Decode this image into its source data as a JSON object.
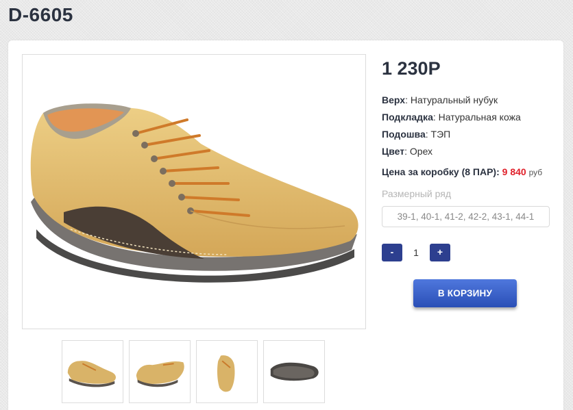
{
  "product": {
    "code": "D-6605",
    "price": "1 230Р"
  },
  "specs": [
    {
      "label": "Верх",
      "value": "Натуральный нубук"
    },
    {
      "label": "Подкладка",
      "value": "Натуральная кожа"
    },
    {
      "label": "Подошва",
      "value": "ТЭП"
    },
    {
      "label": "Цвет",
      "value": "Орех"
    }
  ],
  "box_price": {
    "label": "Цена за коробку (8 ПАР):",
    "value": "9 840",
    "currency": "руб"
  },
  "sizes": {
    "label": "Размерный ряд",
    "value": "39-1, 40-1, 41-2, 42-2, 43-1, 44-1"
  },
  "quantity": {
    "minus_label": "-",
    "value": "1",
    "plus_label": "+"
  },
  "cart": {
    "button_label": "В КОРЗИНУ"
  },
  "gallery": {
    "thumbnails": [
      "shoe-side-view",
      "shoe-angled-view",
      "shoe-front-view",
      "shoe-sole-view"
    ]
  },
  "colors": {
    "button_blue": "#2d3f8f",
    "cart_button": "#3a5fc8",
    "price_red": "#e0202a",
    "title_text": "#2b3240"
  }
}
